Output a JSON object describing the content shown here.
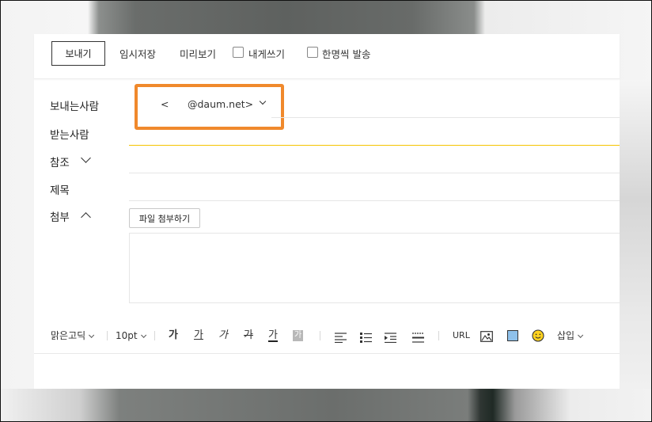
{
  "toolbar": {
    "send_label": "보내기",
    "save_draft_label": "임시저장",
    "preview_label": "미리보기",
    "to_myself_label": "내게쓰기",
    "individual_send_label": "한명씩 발송"
  },
  "form": {
    "sender_label": "보내는사람",
    "sender_prefix": "<",
    "sender_address": "@daum.net>",
    "recipient_label": "받는사람",
    "cc_label": "참조",
    "subject_label": "제목",
    "attach_label": "첨부",
    "attach_button_label": "파일 첨부하기"
  },
  "editor": {
    "font_family": "맑은고딕",
    "font_size": "10pt",
    "bold_glyph": "가",
    "underline_glyph": "가",
    "italic_glyph": "가",
    "strike_glyph": "가",
    "font_color_glyph": "가",
    "bg_color_glyph": "가",
    "url_label": "URL",
    "insert_label": "삽입"
  },
  "colors": {
    "highlight": "#f0892c",
    "active_underline": "#f5c400",
    "bg_color_swatch": "#8fc1ea"
  }
}
